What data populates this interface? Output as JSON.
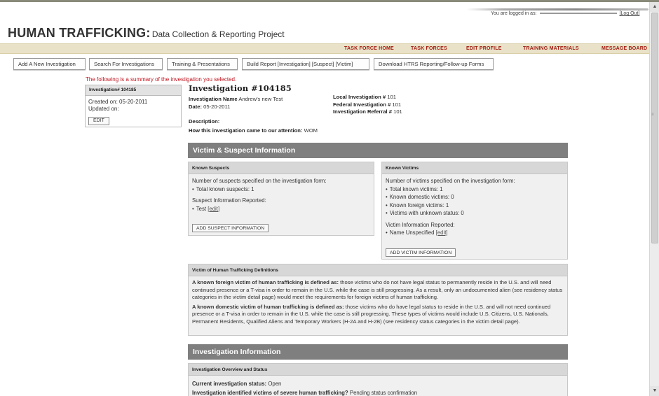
{
  "header": {
    "logged_in_label": "You are logged in as:",
    "logout_label": "[Log Out]",
    "title_main": "HUMAN TRAFFICKING:",
    "title_sub": "Data Collection & Reporting Project"
  },
  "nav": {
    "items": [
      "TASK FORCE HOME",
      "TASK FORCES",
      "EDIT PROFILE",
      "TRAINING MATERIALS",
      "MESSAGE BOARD"
    ]
  },
  "toolbar": {
    "buttons": [
      "Add A New Investigation",
      "Search For Investigations",
      "Training & Presentations",
      "Build Report [Investigation] [Suspect] [Victim]",
      "Download HTRS Reporting/Follow-up Forms"
    ]
  },
  "summary_note": "The following is a summary of the investigation you selected.",
  "sidecard": {
    "header": "Investigation# 104185",
    "created": "Created on: 05-20-2011",
    "updated": "Updated on:",
    "edit_label": "EDIT"
  },
  "investigation": {
    "title": "Investigation #104185",
    "name_label": "Investigation Name",
    "name_value": "Andrew's new Test",
    "date_label": "Date:",
    "date_value": "05-20-2011",
    "local_label": "Local Investigation #",
    "local_value": "101",
    "federal_label": "Federal Investigation #",
    "federal_value": "101",
    "referral_label": "Investigation Referral #",
    "referral_value": "101",
    "description_label": "Description:",
    "attention_label": "How this investigation came to our attention:",
    "attention_value": "WOM"
  },
  "victim_suspect": {
    "section_title": "Victim & Suspect Information",
    "suspects": {
      "header": "Known Suspects",
      "intro": "Number of suspects specified on the investigation form:",
      "items": [
        "Total known suspects: 1"
      ],
      "reported_label": "Suspect Information Reported:",
      "reported_name": "Test",
      "edit_link": "[edit]",
      "add_button": "ADD SUSPECT INFORMATION"
    },
    "victims": {
      "header": "Known Victims",
      "intro": "Number of victims specified on the investigation form:",
      "items": [
        "Total known victims: 1",
        "Known domestic victims: 0",
        "Known foreign victims: 1",
        "Victims with unknown status: 0"
      ],
      "reported_label": "Victim Information Reported:",
      "reported_name": "Name Unspecified",
      "edit_link": "[edit]",
      "add_button": "ADD VICTIM INFORMATION"
    }
  },
  "definitions": {
    "header": "Victim of Human Trafficking Definitions",
    "foreign_bold": "A known foreign victim of human trafficking is defined as:",
    "foreign_text": " those victims who do not have legal status to permanently reside in the U.S. and will need continued presence or a T-visa in order to remain in the U.S. while the case is still progressing. As a result, only an undocumented alien (see residency status categories in the victim detail page) would meet the requirements for foreign victims of human trafficking.",
    "domestic_bold": "A known domestic victim of human trafficking is defined as:",
    "domestic_text": " those victims who do have legal status to reside in the U.S. and will not need continued presence or a T-visa in order to remain in the U.S. while the case is still progressing. These types of victims would include U.S. Citizens, U.S. Nationals, Permanent Residents, Qualified Aliens and Temporary Workers (H-2A and H-2B) (see residency status categories in the victim detail page)."
  },
  "investigation_info": {
    "section_title": "Investigation Information",
    "panel_header": "Investigation Overview and Status",
    "status_label": "Current investigation status:",
    "status_value": "Open",
    "severe_label": "Investigation identified victims of severe human trafficking?",
    "severe_value": "Pending status confirmation"
  }
}
